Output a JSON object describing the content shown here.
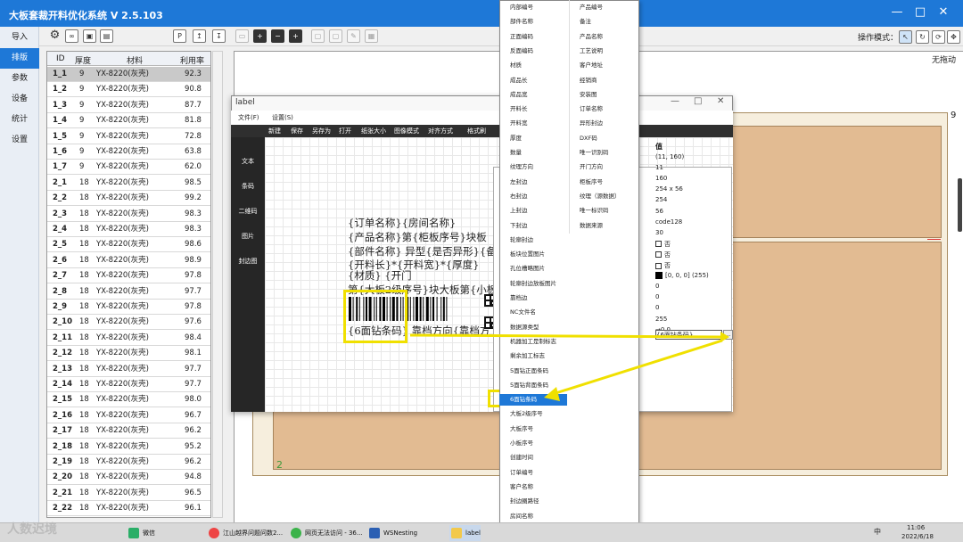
{
  "app": {
    "title": "大板套裁开料优化系统 V 2.5.103"
  },
  "window_controls": {
    "min": "—",
    "max": "□",
    "close": "✕"
  },
  "nav": {
    "items": [
      "导入",
      "排版",
      "参数",
      "设备",
      "统计",
      "设置"
    ],
    "active": 1
  },
  "toolbar": {
    "operation_mode_label": "操作模式："
  },
  "table": {
    "headers": [
      "ID",
      "厚度",
      "材料",
      "利用率"
    ],
    "rows": [
      [
        "1_1",
        "9",
        "YX-8220(灰壳)",
        "92.3"
      ],
      [
        "1_2",
        "9",
        "YX-8220(灰壳)",
        "90.8"
      ],
      [
        "1_3",
        "9",
        "YX-8220(灰壳)",
        "87.7"
      ],
      [
        "1_4",
        "9",
        "YX-8220(灰壳)",
        "81.8"
      ],
      [
        "1_5",
        "9",
        "YX-8220(灰壳)",
        "72.8"
      ],
      [
        "1_6",
        "9",
        "YX-8220(灰壳)",
        "63.8"
      ],
      [
        "1_7",
        "9",
        "YX-8220(灰壳)",
        "62.0"
      ],
      [
        "2_1",
        "18",
        "YX-8220(灰壳)",
        "98.5"
      ],
      [
        "2_2",
        "18",
        "YX-8220(灰壳)",
        "99.2"
      ],
      [
        "2_3",
        "18",
        "YX-8220(灰壳)",
        "98.3"
      ],
      [
        "2_4",
        "18",
        "YX-8220(灰壳)",
        "98.3"
      ],
      [
        "2_5",
        "18",
        "YX-8220(灰壳)",
        "98.6"
      ],
      [
        "2_6",
        "18",
        "YX-8220(灰壳)",
        "98.9"
      ],
      [
        "2_7",
        "18",
        "YX-8220(灰壳)",
        "97.8"
      ],
      [
        "2_8",
        "18",
        "YX-8220(灰壳)",
        "97.7"
      ],
      [
        "2_9",
        "18",
        "YX-8220(灰壳)",
        "97.8"
      ],
      [
        "2_10",
        "18",
        "YX-8220(灰壳)",
        "97.6"
      ],
      [
        "2_11",
        "18",
        "YX-8220(灰壳)",
        "98.4"
      ],
      [
        "2_12",
        "18",
        "YX-8220(灰壳)",
        "98.1"
      ],
      [
        "2_13",
        "18",
        "YX-8220(灰壳)",
        "97.7"
      ],
      [
        "2_14",
        "18",
        "YX-8220(灰壳)",
        "97.7"
      ],
      [
        "2_15",
        "18",
        "YX-8220(灰壳)",
        "98.0"
      ],
      [
        "2_16",
        "18",
        "YX-8220(灰壳)",
        "96.7"
      ],
      [
        "2_17",
        "18",
        "YX-8220(灰壳)",
        "96.2"
      ],
      [
        "2_18",
        "18",
        "YX-8220(灰壳)",
        "95.2"
      ],
      [
        "2_19",
        "18",
        "YX-8220(灰壳)",
        "96.2"
      ],
      [
        "2_20",
        "18",
        "YX-8220(灰壳)",
        "94.8"
      ],
      [
        "2_21",
        "18",
        "YX-8220(灰壳)",
        "96.5"
      ],
      [
        "2_22",
        "18",
        "YX-8220(灰壳)",
        "96.1"
      ]
    ],
    "selected_row": 0
  },
  "canvas": {
    "no_drag_label": "无拖动",
    "board_number_top": "9",
    "board_number_bottom": "2"
  },
  "label_window": {
    "title": "label",
    "menu": [
      "文件(F)",
      "设置(S)"
    ],
    "tools": [
      "新建",
      "保存",
      "另存为",
      "打开",
      "纸张大小",
      "图像模式",
      "对齐方式",
      "格式刷",
      "删除"
    ],
    "side": [
      "文本",
      "条码",
      "二维码",
      "图片",
      "封边图"
    ],
    "lines": [
      "{订单名称}{房间名称}",
      "{产品名称}第{柜板序号}块板",
      "{部件名称} 异型{是否异形}{备",
      "{开料长}*{开料宽}*{厚度}",
      "{材质}                    {开门",
      "第{大板2级序号}块大板第{小板",
      "{6面钻条码} 靠档方向{靠档方"
    ]
  },
  "properties": {
    "header": "值",
    "values": [
      "(11, 160)",
      "11",
      "160",
      "254 x 56",
      "254",
      "56",
      "code128",
      "30",
      "否",
      "否",
      "否",
      "[0, 0, 0] (255)",
      "0",
      "0",
      "0",
      "255",
      "→0.0"
    ],
    "input_value": "{6面钻条码}"
  },
  "dropdown": {
    "col1": [
      "内部编号",
      "部件名称",
      "正面编码",
      "反面编码",
      "材质",
      "成品长",
      "成品宽",
      "开料长",
      "开料宽",
      "厚度",
      "数量",
      "纹理方向",
      "左封边",
      "右封边",
      "上封边",
      "下封边",
      "轮廓封边",
      "板块位置图片",
      "孔位槽略图片",
      "轮廓封边放板图片",
      "靠档边",
      "NC文件名",
      "数据源类型",
      "机器加工是制标志",
      "剩余加工标志",
      "5面钻正面条码",
      "5面钻背面条码",
      "6面钻条码",
      "大板2级序号",
      "大板序号",
      "小板序号",
      "创建时间",
      "订单编号",
      "客户名称",
      "封边圈路径",
      "房间名称",
      "是否异形"
    ],
    "col2": [
      "产品编号",
      "备注",
      "产品名称",
      "工艺说明",
      "客户地址",
      "经销商",
      "安装图",
      "订单名称",
      "异形封边",
      "DXF码",
      "唯一识别码",
      "开门方向",
      "柜板序号",
      "纹理（源数据）",
      "唯一标识码",
      "数据来源"
    ],
    "highlight_index": 27
  },
  "taskbar": {
    "items": [
      "微信",
      "江山越界问题问数2...",
      "网页无法访问 - 36...",
      "WSNesting",
      "label"
    ],
    "time": "11:06",
    "date": "2022/6/18",
    "lang": "中",
    "watermark": "人数迟境"
  },
  "colors": {
    "titlebar": "#1e78d7",
    "board": "#e2bb92",
    "highlight": "#f0e000",
    "nav_active": "#1e78d7"
  }
}
